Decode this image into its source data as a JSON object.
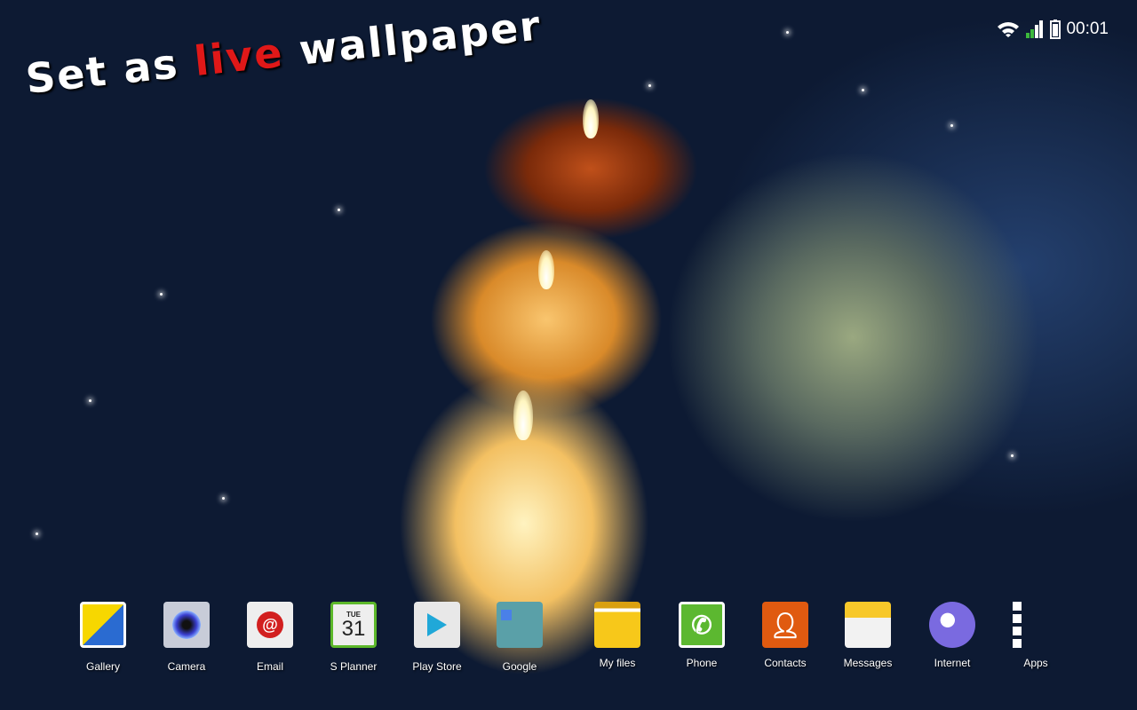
{
  "status_bar": {
    "time": "00:01",
    "icons": [
      "wifi-icon",
      "signal-icon",
      "battery-icon"
    ]
  },
  "promo": {
    "part1": "Set as ",
    "highlight": "live",
    "part2": " wallpaper",
    "highlight_color": "#e01818"
  },
  "dock": [
    {
      "label": "Gallery",
      "icon": "gallery-icon"
    },
    {
      "label": "Camera",
      "icon": "camera-icon"
    },
    {
      "label": "Email",
      "icon": "email-icon"
    },
    {
      "label": "S Planner",
      "icon": "calendar-icon",
      "day": "TUE",
      "date": "31"
    },
    {
      "label": "Play Store",
      "icon": "play-store-icon"
    },
    {
      "label": "Google",
      "icon": "google-folder-icon"
    },
    {
      "label": "My files",
      "icon": "folder-icon"
    },
    {
      "label": "Phone",
      "icon": "phone-icon"
    },
    {
      "label": "Contacts",
      "icon": "contacts-icon"
    },
    {
      "label": "Messages",
      "icon": "messages-icon"
    },
    {
      "label": "Internet",
      "icon": "globe-icon"
    },
    {
      "label": "Apps",
      "icon": "apps-grid-icon"
    }
  ]
}
